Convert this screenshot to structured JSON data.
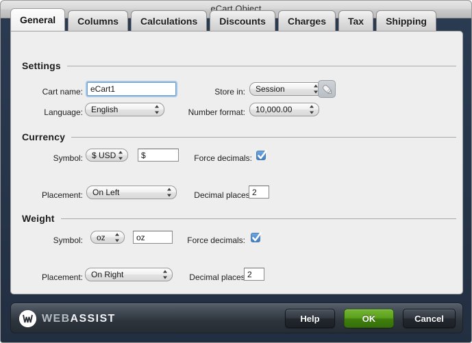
{
  "window": {
    "title": "eCart Object"
  },
  "tabs": [
    {
      "label": "General",
      "active": true
    },
    {
      "label": "Columns",
      "active": false
    },
    {
      "label": "Calculations",
      "active": false
    },
    {
      "label": "Discounts",
      "active": false
    },
    {
      "label": "Charges",
      "active": false
    },
    {
      "label": "Tax",
      "active": false
    },
    {
      "label": "Shipping",
      "active": false
    }
  ],
  "sections": {
    "settings": {
      "title": "Settings",
      "cart_name_label": "Cart name:",
      "cart_name_value": "eCart1",
      "language_label": "Language:",
      "language_value": "English",
      "store_in_label": "Store in:",
      "store_in_value": "Session",
      "edit_button_icon": "pencil-icon",
      "number_format_label": "Number format:",
      "number_format_value": "10,000.00"
    },
    "currency": {
      "title": "Currency",
      "symbol_label": "Symbol:",
      "symbol_select_value": "$ USD",
      "symbol_text_value": "$",
      "force_decimals_label": "Force decimals:",
      "force_decimals_checked": true,
      "placement_label": "Placement:",
      "placement_value": "On Left",
      "decimal_places_label": "Decimal places:",
      "decimal_places_value": "2"
    },
    "weight": {
      "title": "Weight",
      "symbol_label": "Symbol:",
      "symbol_select_value": "oz",
      "symbol_text_value": "oz",
      "force_decimals_label": "Force decimals:",
      "force_decimals_checked": true,
      "placement_label": "Placement:",
      "placement_value": "On Right",
      "decimal_places_label": "Decimal places:",
      "decimal_places_value": "2"
    }
  },
  "footer": {
    "brand_web": "WEB",
    "brand_assist": "ASSIST",
    "help_label": "Help",
    "ok_label": "OK",
    "cancel_label": "Cancel"
  },
  "colors": {
    "chrome_navy": "#27354a",
    "panel_bg": "#eeeeee",
    "accent_blue": "#4f86c6",
    "ok_green": "#5da21f",
    "titlebar_gray": "#d8d8d8"
  }
}
